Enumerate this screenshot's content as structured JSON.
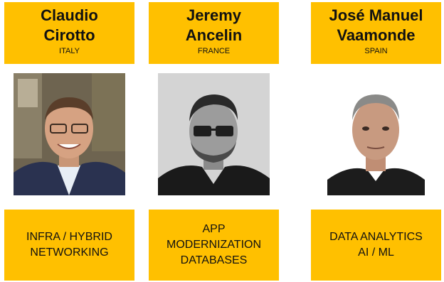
{
  "people": [
    {
      "name_lines": [
        "Claudio",
        "Cirotto"
      ],
      "country": "ITALY",
      "focus_lines": [
        "INFRA / HYBRID",
        "NETWORKING"
      ],
      "photo_icon": "portrait-photo"
    },
    {
      "name_lines": [
        "Jeremy",
        "Ancelin"
      ],
      "country": "FRANCE",
      "focus_lines": [
        "APP",
        "MODERNIZATION",
        "DATABASES"
      ],
      "photo_icon": "portrait-photo-grayscale"
    },
    {
      "name_lines": [
        "José Manuel",
        "Vaamonde"
      ],
      "country": "SPAIN",
      "focus_lines": [
        "DATA ANALYTICS",
        "AI / ML"
      ],
      "photo_icon": "portrait-photo"
    }
  ],
  "colors": {
    "accent": "#ffc000",
    "text": "#111111"
  }
}
